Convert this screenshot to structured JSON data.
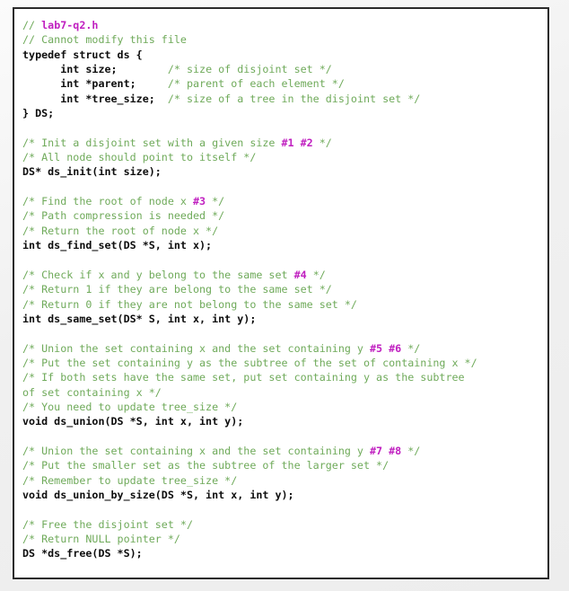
{
  "window": {
    "background_color": "#f2f2f2",
    "box_background_color": "#ffffff",
    "box_border_color": "#2b2b2b"
  },
  "theme": {
    "comment_color": "#6faa5a",
    "marker_color": "#c020c0",
    "code_color": "#0d0d0d"
  },
  "code": {
    "language": "c",
    "file_name": "lab7-q2.h",
    "lines": [
      {
        "segments": [
          {
            "t": "// ",
            "k": "cm"
          },
          {
            "t": "lab7-q2.h",
            "k": "hl"
          }
        ]
      },
      {
        "segments": [
          {
            "t": "// Cannot modify this file",
            "k": "cm"
          }
        ]
      },
      {
        "segments": [
          {
            "t": "typedef struct ds {",
            "k": "cd"
          }
        ]
      },
      {
        "segments": [
          {
            "t": "      int size;        ",
            "k": "cd"
          },
          {
            "t": "/* size of disjoint set */",
            "k": "cm"
          }
        ]
      },
      {
        "segments": [
          {
            "t": "      int *parent;     ",
            "k": "cd"
          },
          {
            "t": "/* parent of each element */",
            "k": "cm"
          }
        ]
      },
      {
        "segments": [
          {
            "t": "      int *tree_size;  ",
            "k": "cd"
          },
          {
            "t": "/* size of a tree in the disjoint set */",
            "k": "cm"
          }
        ]
      },
      {
        "segments": [
          {
            "t": "} DS;",
            "k": "cd"
          }
        ]
      },
      {
        "segments": []
      },
      {
        "segments": [
          {
            "t": "/* Init a disjoint set with a given size ",
            "k": "cm"
          },
          {
            "t": "#1 #2",
            "k": "hl"
          },
          {
            "t": " */",
            "k": "cm"
          }
        ]
      },
      {
        "segments": [
          {
            "t": "/* All node should point to itself */",
            "k": "cm"
          }
        ]
      },
      {
        "segments": [
          {
            "t": "DS* ds_init(int size);",
            "k": "cd"
          }
        ]
      },
      {
        "segments": []
      },
      {
        "segments": [
          {
            "t": "/* Find the root of node x ",
            "k": "cm"
          },
          {
            "t": "#3",
            "k": "hl"
          },
          {
            "t": " */",
            "k": "cm"
          }
        ]
      },
      {
        "segments": [
          {
            "t": "/* Path compression is needed */",
            "k": "cm"
          }
        ]
      },
      {
        "segments": [
          {
            "t": "/* Return the root of node x */",
            "k": "cm"
          }
        ]
      },
      {
        "segments": [
          {
            "t": "int ds_find_set(DS *S, int x);",
            "k": "cd"
          }
        ]
      },
      {
        "segments": []
      },
      {
        "segments": [
          {
            "t": "/* Check if x and y belong to the same set ",
            "k": "cm"
          },
          {
            "t": "#4",
            "k": "hl"
          },
          {
            "t": " */",
            "k": "cm"
          }
        ]
      },
      {
        "segments": [
          {
            "t": "/* Return 1 if they are belong to the same set */",
            "k": "cm"
          }
        ]
      },
      {
        "segments": [
          {
            "t": "/* Return 0 if they are not belong to the same set */",
            "k": "cm"
          }
        ]
      },
      {
        "segments": [
          {
            "t": "int ds_same_set(DS* S, int x, int y);",
            "k": "cd"
          }
        ]
      },
      {
        "segments": []
      },
      {
        "segments": [
          {
            "t": "/* Union the set containing x and the set containing y ",
            "k": "cm"
          },
          {
            "t": "#5 #6",
            "k": "hl"
          },
          {
            "t": " */",
            "k": "cm"
          }
        ]
      },
      {
        "segments": [
          {
            "t": "/* Put the set containing y as the subtree of the set of containing x */",
            "k": "cm"
          }
        ]
      },
      {
        "segments": [
          {
            "t": "/* If both sets have the same set, put set containing y as the subtree",
            "k": "cm"
          }
        ]
      },
      {
        "segments": [
          {
            "t": "of set containing x */",
            "k": "cm"
          }
        ]
      },
      {
        "segments": [
          {
            "t": "/* You need to update tree_size */",
            "k": "cm"
          }
        ]
      },
      {
        "segments": [
          {
            "t": "void ds_union(DS *S, int x, int y);",
            "k": "cd"
          }
        ]
      },
      {
        "segments": []
      },
      {
        "segments": [
          {
            "t": "/* Union the set containing x and the set containing y ",
            "k": "cm"
          },
          {
            "t": "#7 #8",
            "k": "hl"
          },
          {
            "t": " */",
            "k": "cm"
          }
        ]
      },
      {
        "segments": [
          {
            "t": "/* Put the smaller set as the subtree of the larger set */",
            "k": "cm"
          }
        ]
      },
      {
        "segments": [
          {
            "t": "/* Remember to update tree_size */",
            "k": "cm"
          }
        ]
      },
      {
        "segments": [
          {
            "t": "void ds_union_by_size(DS *S, int x, int y);",
            "k": "cd"
          }
        ]
      },
      {
        "segments": []
      },
      {
        "segments": [
          {
            "t": "/* Free the disjoint set */",
            "k": "cm"
          }
        ]
      },
      {
        "segments": [
          {
            "t": "/* Return NULL pointer */",
            "k": "cm"
          }
        ]
      },
      {
        "segments": [
          {
            "t": "DS *ds_free(DS *S);",
            "k": "cd"
          }
        ]
      }
    ]
  }
}
